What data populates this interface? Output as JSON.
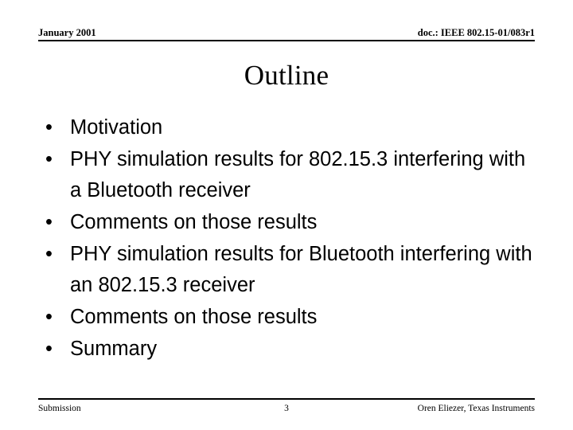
{
  "slide": {
    "header": {
      "date": "January 2001",
      "doc_reference": "doc.: IEEE 802.15-01/083r1"
    },
    "title": "Outline",
    "bullet_mark": "•",
    "bullets": [
      {
        "text": "Motivation"
      },
      {
        "text": "PHY simulation results for 802.15.3 interfering with a Bluetooth receiver"
      },
      {
        "text": "Comments on those results"
      },
      {
        "text": "PHY simulation results for Bluetooth interfering with an 802.15.3 receiver"
      },
      {
        "text": "Comments on those results"
      },
      {
        "text": "Summary"
      }
    ],
    "footer": {
      "left": "Submission",
      "page_number": "3",
      "right": "Oren Eliezer, Texas Instruments"
    }
  }
}
